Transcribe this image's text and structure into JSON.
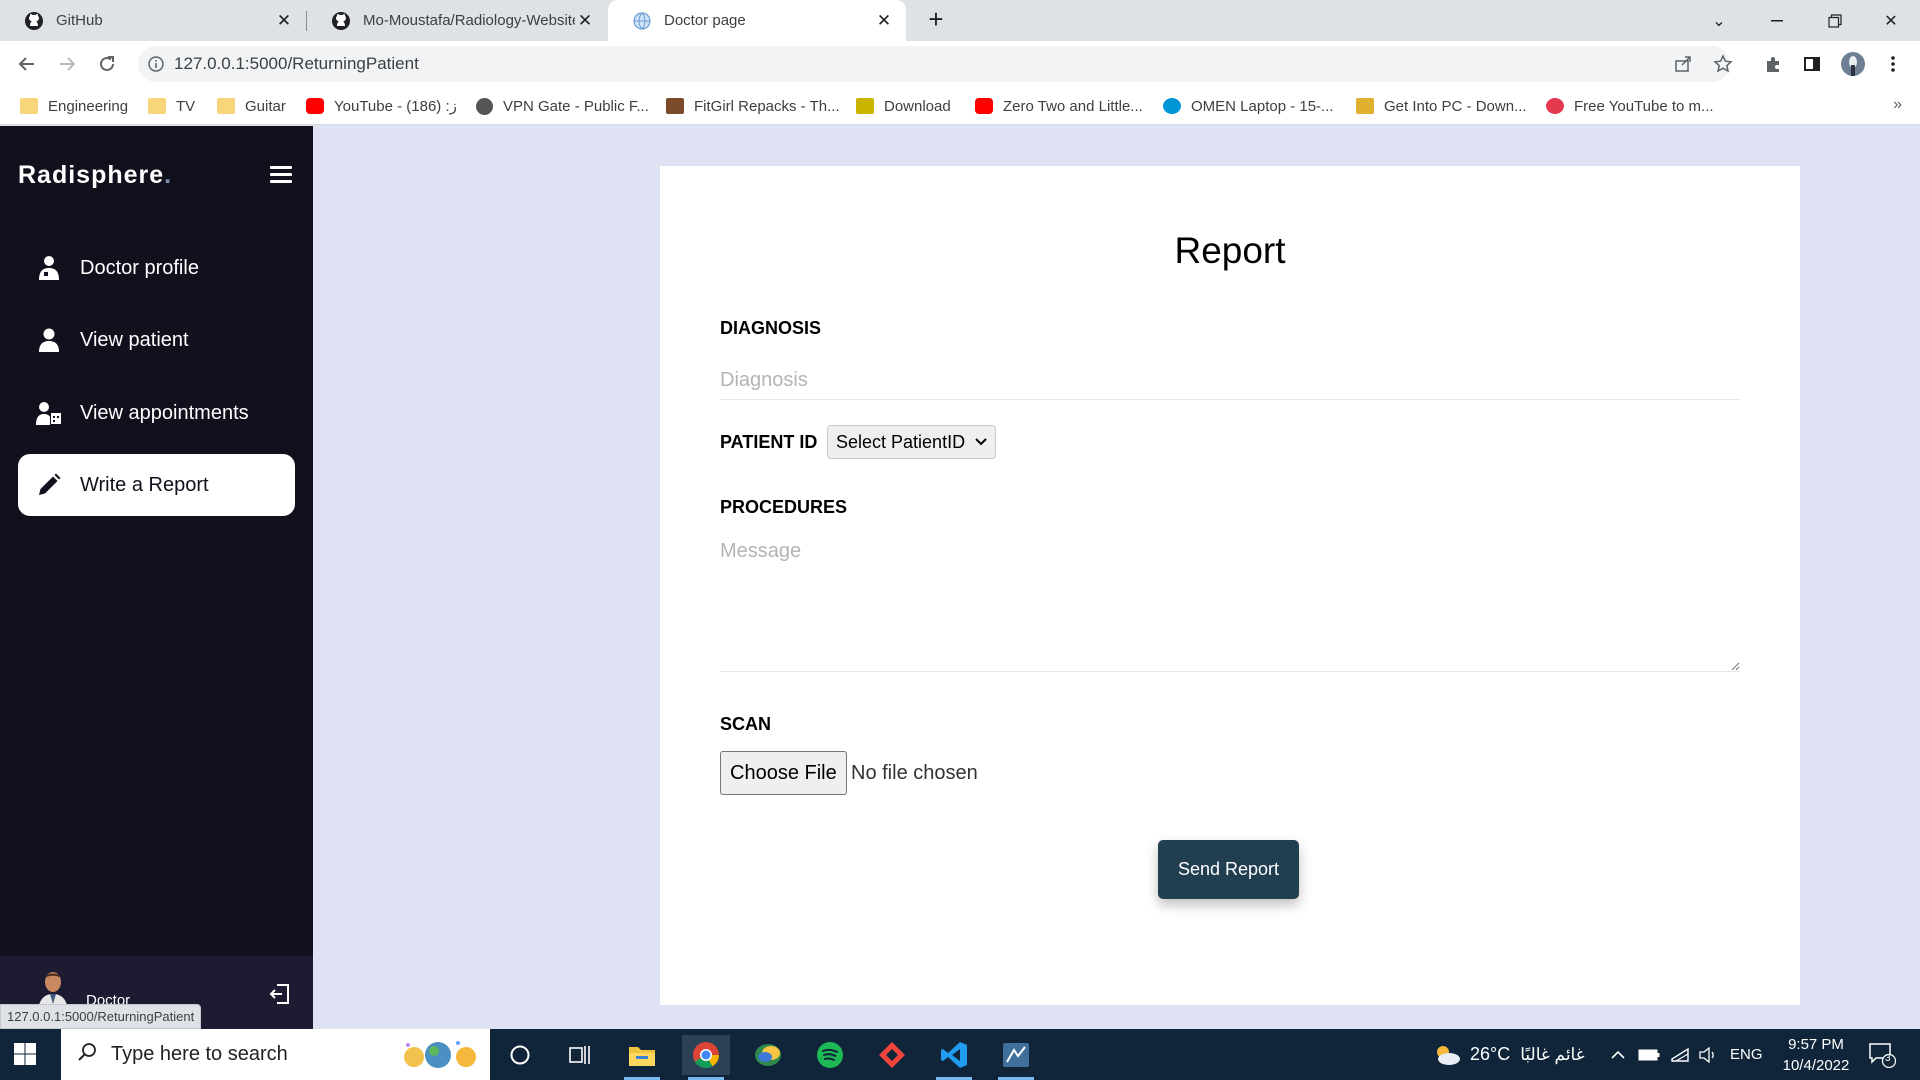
{
  "browser": {
    "tabs": [
      {
        "title": "GitHub",
        "icon": "github-icon"
      },
      {
        "title": "Mo-Moustafa/Radiology-Website",
        "icon": "github-icon"
      },
      {
        "title": "Doctor page",
        "icon": "globe-icon"
      }
    ],
    "url": "127.0.0.1:5000/ReturningPatient",
    "status_url": "127.0.0.1:5000/ReturningPatient",
    "bookmarks": [
      {
        "label": "Engineering",
        "icon": "folder-icon"
      },
      {
        "label": "TV",
        "icon": "folder-icon"
      },
      {
        "label": "Guitar",
        "icon": "folder-icon"
      },
      {
        "label": "YouTube - (186) :ز",
        "icon": "youtube-icon"
      },
      {
        "label": "VPN Gate - Public F...",
        "icon": "vpn-icon"
      },
      {
        "label": "FitGirl Repacks - Th...",
        "icon": "fitgirl-icon"
      },
      {
        "label": "Download",
        "icon": "download-icon"
      },
      {
        "label": "Zero Two and Little...",
        "icon": "youtube-icon"
      },
      {
        "label": "OMEN Laptop - 15-...",
        "icon": "hp-icon"
      },
      {
        "label": "Get Into PC - Down...",
        "icon": "getintopc-icon"
      },
      {
        "label": "Free YouTube to m...",
        "icon": "converter-icon"
      }
    ],
    "more": "»"
  },
  "sidebar": {
    "brand": "Radisphere",
    "brand_dot": ".",
    "items": [
      {
        "label": "Doctor profile",
        "icon": "doctor-icon"
      },
      {
        "label": "View patient",
        "icon": "user-icon"
      },
      {
        "label": "View appointments",
        "icon": "appointments-icon"
      },
      {
        "label": "Write a Report",
        "icon": "pencil-icon"
      }
    ],
    "active_index": 3,
    "profile_name": "Doctor"
  },
  "report": {
    "title": "Report",
    "diagnosis_label": "DIAGNOSIS",
    "diagnosis_placeholder": "Diagnosis",
    "patient_id_label": "PATIENT ID",
    "patient_id_selected": "Select PatientID",
    "procedures_label": "PROCEDURES",
    "procedures_placeholder": "Message",
    "scan_label": "SCAN",
    "choose_file_label": "Choose File",
    "no_file_text": "No file chosen",
    "send_label": "Send Report"
  },
  "taskbar": {
    "search_placeholder": "Type here to search",
    "weather_temp": "26°C",
    "weather_text": "غائم غالبًا",
    "language": "ENG",
    "time": "9:57 PM",
    "date": "10/4/2022",
    "notification_count": "3"
  },
  "colors": {
    "sidebar_bg": "#11101d",
    "page_bg": "#dee2f3",
    "send_button": "#223f52"
  }
}
